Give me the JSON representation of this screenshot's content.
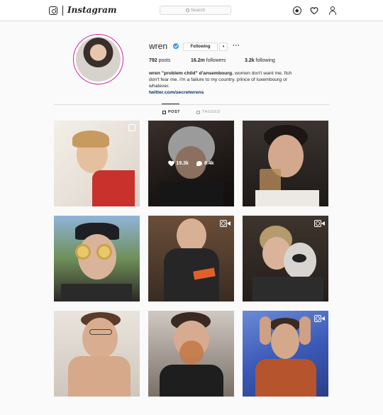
{
  "topbar": {
    "wordmark": "Instagram",
    "search_placeholder": "Search"
  },
  "profile": {
    "username": "wren",
    "follow_label": "Following",
    "caret": "▾",
    "more": "···",
    "posts_count": "792",
    "posts_label": " posts",
    "followers_count": "16.2m",
    "followers_label": " followers",
    "following_count": "3.2k",
    "following_label": " following",
    "bio_name": "wren \"problem child\" d'ansembourg.",
    "bio_text": " women don't want me, fish don't fear me. i'm a failure to my country. prince of luxembourg or whatever.",
    "bio_link": "twitter.com/secretwrens"
  },
  "tabs": {
    "posts": "POST",
    "tagged": "TAGGED"
  },
  "hover_post": {
    "likes": "19.3k",
    "comments": "8.4k"
  },
  "colors": {
    "story_ring": "#d6249f",
    "verified": "#3897f0",
    "link": "#003569"
  }
}
